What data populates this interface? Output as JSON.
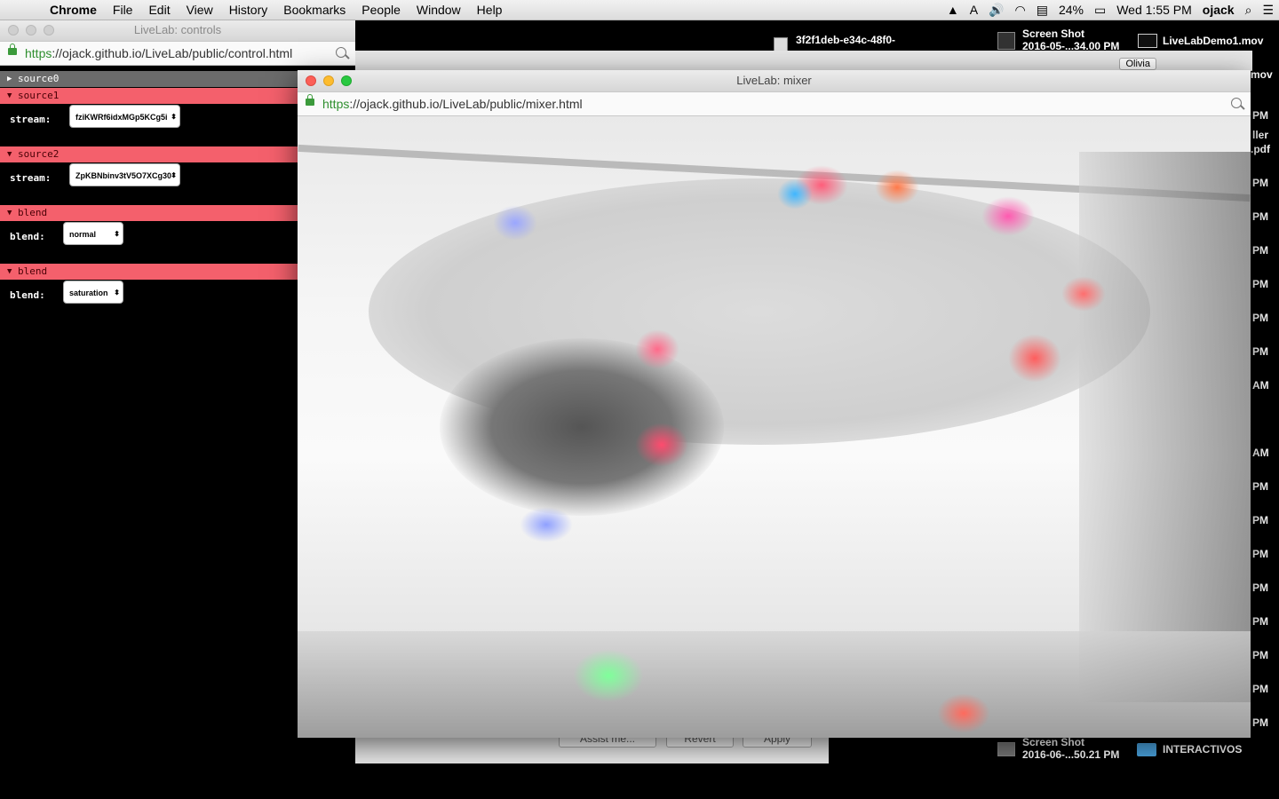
{
  "menubar": {
    "app_name": "Chrome",
    "menus": [
      "File",
      "Edit",
      "View",
      "History",
      "Bookmarks",
      "People",
      "Window",
      "Help"
    ],
    "battery": "24%",
    "clock": "Wed 1:55 PM",
    "user": "ojack"
  },
  "desktop": {
    "file1": "3f2f1deb-e34c-48f0-",
    "file2_line1": "Screen Shot",
    "file2_line2": "2016-05-...34.00 PM",
    "file3": "LiveLabDemo1.mov",
    "file4_line1": "Screen Shot",
    "file4_line2": "2016-06-...50.21 PM",
    "folder": "INTERACTIVOS",
    "side_fragments": [
      "mov",
      "ller",
      ".pdf"
    ],
    "time_labels": [
      "PM",
      "PM",
      "PM",
      "PM",
      "PM",
      "PM",
      "PM",
      "AM",
      "AM",
      "PM",
      "PM",
      "PM",
      "PM",
      "PM",
      "PM",
      "PM",
      "PM",
      "PM"
    ]
  },
  "controls_window": {
    "title": "LiveLab: controls",
    "url_scheme": "https",
    "url_rest": "://ojack.github.io/LiveLab/public/control.html",
    "folders": [
      {
        "name": "source0"
      },
      {
        "name": "source1",
        "label": "stream:",
        "value": "fziKWRf6idxMGp5KCg5i"
      },
      {
        "name": "source2",
        "label": "stream:",
        "value": "ZpKBNbinv3tV5O7XCg30"
      },
      {
        "name": "blend",
        "label": "blend:",
        "value": "normal"
      },
      {
        "name": "blend",
        "label": "blend:",
        "value": "saturation"
      }
    ]
  },
  "background_window": {
    "olivia": "Olivia",
    "assist": "Assist me...",
    "revert": "Revert",
    "apply": "Apply"
  },
  "mixer_window": {
    "title": "LiveLab: mixer",
    "url_scheme": "https",
    "url_rest": "://ojack.github.io/LiveLab/public/mixer.html"
  }
}
